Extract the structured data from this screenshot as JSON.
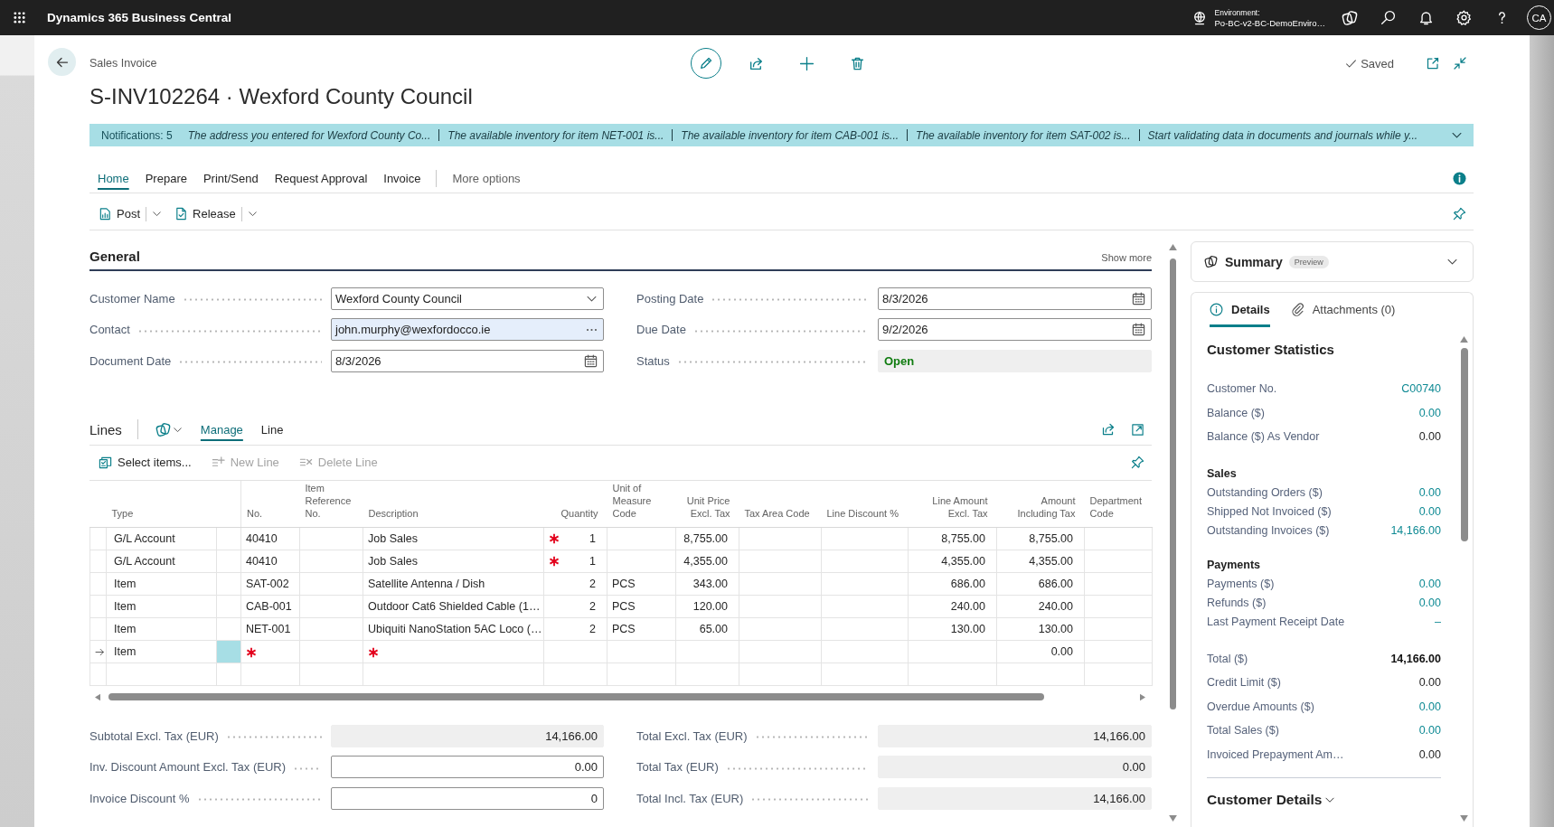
{
  "top_bar": {
    "app_name": "Dynamics 365 Business Central",
    "environment_label": "Environment:",
    "environment_name": "Po-BC-v2-BC-DemoEnviro…",
    "avatar": "CA"
  },
  "header": {
    "page_type": "Sales Invoice",
    "title": "S-INV102264 · Wexford County Council",
    "save_status": "Saved"
  },
  "notifications": {
    "label": "Notifications: 5",
    "messages": [
      "The address you entered for Wexford County Co...",
      "The available inventory for item NET-001 is...",
      "The available inventory for item CAB-001 is...",
      "The available inventory for item SAT-002 is...",
      "Start validating data in documents and journals while y..."
    ]
  },
  "action_tabs": [
    {
      "label": "Home",
      "selected": true
    },
    {
      "label": "Prepare",
      "selected": false
    },
    {
      "label": "Print/Send",
      "selected": false
    },
    {
      "label": "Request Approval",
      "selected": false
    },
    {
      "label": "Invoice",
      "selected": false
    }
  ],
  "more_options": "More options",
  "actions": [
    {
      "label": "Post",
      "kind": "post"
    },
    {
      "label": "Release",
      "kind": "release"
    }
  ],
  "general": {
    "title": "General",
    "show_more": "Show more",
    "left_fields": [
      {
        "label": "Customer Name",
        "value": "Wexford County Council",
        "kind": "dropdown",
        "focused": false
      },
      {
        "label": "Contact",
        "value": "john.murphy@wexfordocco.ie",
        "kind": "lookup",
        "focused": true
      },
      {
        "label": "Document Date",
        "value": "8/3/2026",
        "kind": "date",
        "focused": false
      }
    ],
    "right_fields": [
      {
        "label": "Posting Date",
        "value": "8/3/2026",
        "kind": "date",
        "focused": false
      },
      {
        "label": "Due Date",
        "value": "9/2/2026",
        "kind": "date",
        "focused": false
      },
      {
        "label": "Status",
        "value": "Open",
        "kind": "status",
        "focused": false
      }
    ]
  },
  "lines": {
    "title": "Lines",
    "tabs": [
      {
        "label": "Manage",
        "selected": true
      },
      {
        "label": "Line",
        "selected": false
      }
    ],
    "actions": [
      {
        "label": "Select items...",
        "kind": "select_items",
        "disabled": false
      },
      {
        "label": "New Line",
        "kind": "new_line",
        "disabled": true
      },
      {
        "label": "Delete Line",
        "kind": "delete_line",
        "disabled": true
      }
    ],
    "columns": [
      {
        "label": "Type"
      },
      {
        "label": "No."
      },
      {
        "label": "Item Reference No."
      },
      {
        "label": "Description"
      },
      {
        "label": "Quantity"
      },
      {
        "label": "Unit of Measure Code"
      },
      {
        "label": "Unit Price Excl. Tax"
      },
      {
        "label": "Tax Area Code"
      },
      {
        "label": "Line Discount %"
      },
      {
        "label": "Line Amount Excl. Tax"
      },
      {
        "label": "Amount Including Tax"
      },
      {
        "label": "Department Code"
      }
    ],
    "rows": [
      {
        "current": false,
        "required": {
          "quantity": true
        },
        "cells": {
          "type": "G/L Account",
          "no": "40410",
          "description": "Job Sales",
          "quantity": "1",
          "unit_price_excl_tax": "8,755.00",
          "line_amount_excl_tax": "8,755.00",
          "amount_including_tax": "8,755.00"
        }
      },
      {
        "current": false,
        "required": {
          "quantity": true
        },
        "cells": {
          "type": "G/L Account",
          "no": "40410",
          "description": "Job Sales",
          "quantity": "1",
          "unit_price_excl_tax": "4,355.00",
          "line_amount_excl_tax": "4,355.00",
          "amount_including_tax": "4,355.00"
        }
      },
      {
        "current": false,
        "cells": {
          "type": "Item",
          "no": "SAT-002",
          "description": "Satellite Antenna / Dish",
          "quantity": "2",
          "unit_of_measure_code": "PCS",
          "unit_price_excl_tax": "343.00",
          "line_amount_excl_tax": "686.00",
          "amount_including_tax": "686.00"
        }
      },
      {
        "current": false,
        "cells": {
          "type": "Item",
          "no": "CAB-001",
          "description": "Outdoor Cat6 Shielded Cable (1…",
          "quantity": "2",
          "unit_of_measure_code": "PCS",
          "unit_price_excl_tax": "120.00",
          "line_amount_excl_tax": "240.00",
          "amount_including_tax": "240.00"
        }
      },
      {
        "current": false,
        "cells": {
          "type": "Item",
          "no": "NET-001",
          "description": "Ubiquiti NanoStation 5AC Loco (…",
          "quantity": "2",
          "unit_of_measure_code": "PCS",
          "unit_price_excl_tax": "65.00",
          "line_amount_excl_tax": "130.00",
          "amount_including_tax": "130.00"
        }
      },
      {
        "current": true,
        "required": {
          "no": true,
          "description": true
        },
        "cells": {
          "type": "Item",
          "amount_including_tax": "0.00"
        }
      }
    ]
  },
  "totals": {
    "left": [
      {
        "label": "Subtotal Excl. Tax (EUR)",
        "value": "14,166.00",
        "kind": "readonly"
      },
      {
        "label": "Inv. Discount Amount Excl. Tax (EUR)",
        "value": "0.00",
        "kind": "input"
      },
      {
        "label": "Invoice Discount %",
        "value": "0",
        "kind": "input"
      }
    ],
    "right": [
      {
        "label": "Total Excl. Tax (EUR)",
        "value": "14,166.00",
        "kind": "readonly"
      },
      {
        "label": "Total Tax (EUR)",
        "value": "0.00",
        "kind": "readonly"
      },
      {
        "label": "Total Incl. Tax (EUR)",
        "value": "14,166.00",
        "kind": "readonly"
      }
    ]
  },
  "summary": {
    "title": "Summary",
    "badge": "Preview",
    "tabs": [
      {
        "label": "Details",
        "kind": "details",
        "selected": true
      },
      {
        "label": "Attachments (0)",
        "kind": "attachments",
        "selected": false
      }
    ],
    "statistics_title": "Customer Statistics",
    "groups": [
      {
        "rows": [
          {
            "label": "Customer No.",
            "value": "C00740",
            "kind": "link"
          },
          {
            "label": "Balance ($)",
            "value": "0.00",
            "kind": "link"
          },
          {
            "label": "Balance ($) As Vendor",
            "value": "0.00",
            "kind": "plain"
          }
        ]
      },
      {
        "heading": "Sales",
        "rows": [
          {
            "label": "Outstanding Orders ($)",
            "value": "0.00",
            "kind": "link"
          },
          {
            "label": "Shipped Not Invoiced ($)",
            "value": "0.00",
            "kind": "link"
          },
          {
            "label": "Outstanding Invoices ($)",
            "value": "14,166.00",
            "kind": "link"
          }
        ]
      },
      {
        "heading": "Payments",
        "rows": [
          {
            "label": "Payments ($)",
            "value": "0.00",
            "kind": "link"
          },
          {
            "label": "Refunds ($)",
            "value": "0.00",
            "kind": "link"
          },
          {
            "label": "Last Payment Receipt Date",
            "value": "–",
            "kind": "link"
          }
        ]
      },
      {
        "rows": [
          {
            "label": "Total ($)",
            "value": "14,166.00",
            "kind": "total"
          },
          {
            "label": "Credit Limit ($)",
            "value": "0.00",
            "kind": "plain"
          },
          {
            "label": "Overdue Amounts ($)",
            "value": "0.00",
            "kind": "link"
          },
          {
            "label": "Total Sales ($)",
            "value": "0.00",
            "kind": "link"
          },
          {
            "label": "Invoiced Prepayment Am…",
            "value": "0.00",
            "kind": "plain"
          }
        ]
      }
    ],
    "details_section": "Customer Details"
  }
}
